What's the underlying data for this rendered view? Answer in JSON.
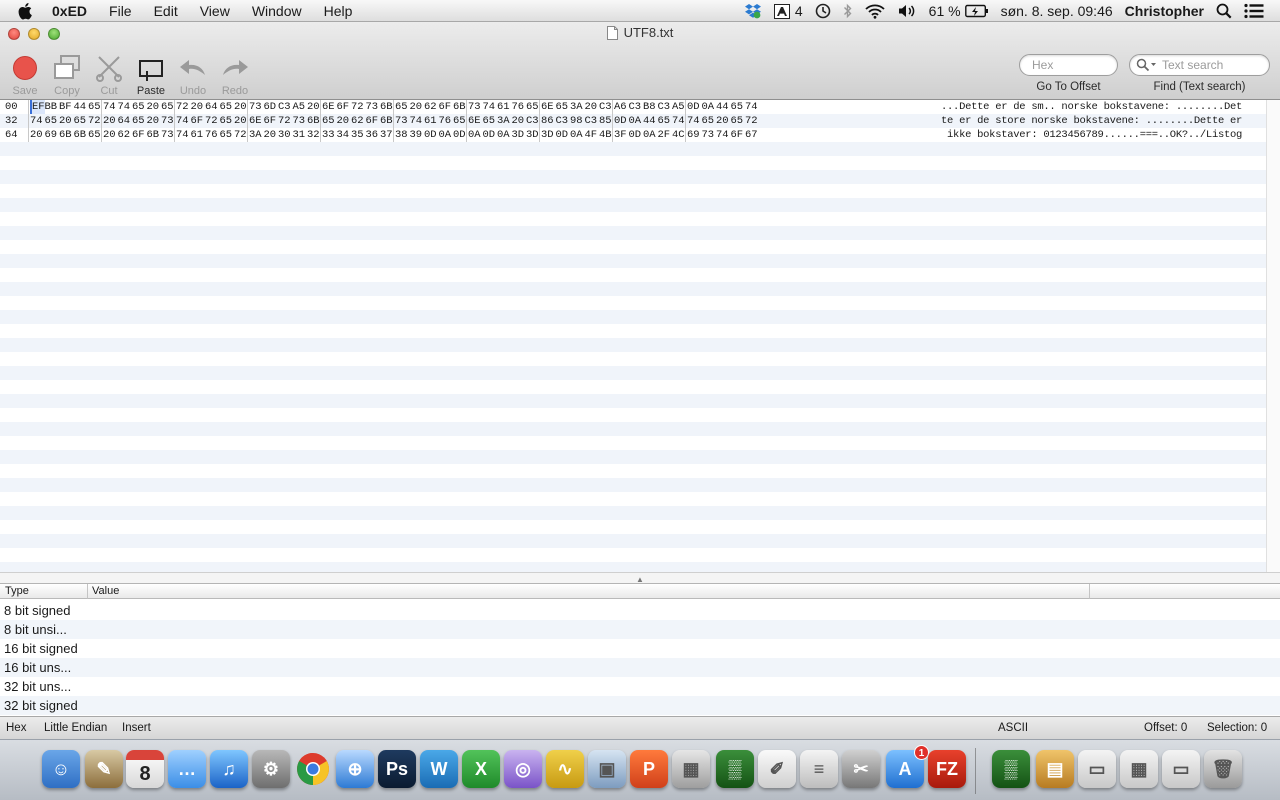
{
  "menubar": {
    "app_name": "0xED",
    "menus": [
      "File",
      "Edit",
      "View",
      "Window",
      "Help"
    ],
    "status": {
      "adobe_count": "4",
      "battery": "61 %",
      "datetime": "søn. 8. sep.  09:46",
      "user": "Christopher"
    }
  },
  "window": {
    "title": "UTF8.txt",
    "toolbar": {
      "save": "Save",
      "copy": "Copy",
      "cut": "Cut",
      "paste": "Paste",
      "undo": "Undo",
      "redo": "Redo",
      "hex_placeholder": "Hex",
      "text_search_placeholder": "Text search",
      "go_to_offset": "Go To Offset",
      "find_label": "Find (Text search)"
    }
  },
  "hex": {
    "rows": [
      {
        "offset": "00",
        "bytes": [
          "EF",
          "BB",
          "BF",
          "44",
          "65",
          "74",
          "74",
          "65",
          "20",
          "65",
          "72",
          "20",
          "64",
          "65",
          "20",
          "73",
          "6D",
          "C3",
          "A5",
          "20",
          "6E",
          "6F",
          "72",
          "73",
          "6B",
          "65",
          "20",
          "62",
          "6F",
          "6B",
          "73",
          "74",
          "61",
          "76",
          "65",
          "6E",
          "65",
          "3A",
          "20",
          "C3",
          "A6",
          "C3",
          "B8",
          "C3",
          "A5",
          "0D",
          "0A",
          "44",
          "65",
          "74"
        ],
        "ascii": "...Dette er de sm.. norske bokstavene: ........Det"
      },
      {
        "offset": "32",
        "bytes": [
          "74",
          "65",
          "20",
          "65",
          "72",
          "20",
          "64",
          "65",
          "20",
          "73",
          "74",
          "6F",
          "72",
          "65",
          "20",
          "6E",
          "6F",
          "72",
          "73",
          "6B",
          "65",
          "20",
          "62",
          "6F",
          "6B",
          "73",
          "74",
          "61",
          "76",
          "65",
          "6E",
          "65",
          "3A",
          "20",
          "C3",
          "86",
          "C3",
          "98",
          "C3",
          "85",
          "0D",
          "0A",
          "44",
          "65",
          "74",
          "74",
          "65",
          "20",
          "65",
          "72"
        ],
        "ascii": "te er de store norske bokstavene: ........Dette er"
      },
      {
        "offset": "64",
        "bytes": [
          "20",
          "69",
          "6B",
          "6B",
          "65",
          "20",
          "62",
          "6F",
          "6B",
          "73",
          "74",
          "61",
          "76",
          "65",
          "72",
          "3A",
          "20",
          "30",
          "31",
          "32",
          "33",
          "34",
          "35",
          "36",
          "37",
          "38",
          "39",
          "0D",
          "0A",
          "0D",
          "0A",
          "0D",
          "0A",
          "3D",
          "3D",
          "3D",
          "0D",
          "0A",
          "4F",
          "4B",
          "3F",
          "0D",
          "0A",
          "2F",
          "4C",
          "69",
          "73",
          "74",
          "6F",
          "67"
        ],
        "ascii": " ikke bokstaver: 0123456789......===..OK?../Listog"
      }
    ]
  },
  "type_table": {
    "headers": {
      "type": "Type",
      "value": "Value"
    },
    "rows": [
      "8 bit signed",
      "8 bit unsi...",
      "16 bit signed",
      "16 bit uns...",
      "32 bit uns...",
      "32 bit signed"
    ]
  },
  "statusbar": {
    "mode": "Hex",
    "endian": "Little Endian",
    "insert": "Insert",
    "encoding": "ASCII",
    "offset": "Offset: 0",
    "selection": "Selection: 0"
  },
  "dock": {
    "apps": [
      "finder-icon",
      "preview-icon",
      "calendar-icon",
      "messages-icon",
      "itunes-icon",
      "system-preferences-icon",
      "chrome-icon",
      "safari-icon",
      "photoshop-icon",
      "word-icon",
      "excel-icon",
      "eclipse-icon",
      "app-icon",
      "iphoto-icon",
      "powerpoint-icon",
      "calculator-icon",
      "terminal-icon",
      "textedit-icon",
      "pages-icon",
      "utilities-icon",
      "app-store-icon",
      "filezilla-icon",
      "activity-icon",
      "installer-icon",
      "window-icon",
      "window-icon-2",
      "window-icon-3",
      "trash-icon"
    ],
    "calendar_day": "8",
    "app_store_badge": "1"
  }
}
